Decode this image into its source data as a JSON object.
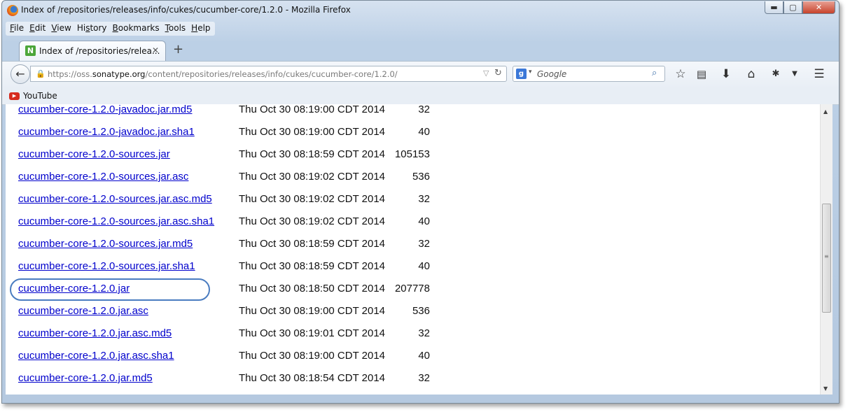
{
  "window": {
    "title": "Index of /repositories/releases/info/cukes/cucumber-core/1.2.0 - Mozilla Firefox",
    "controls": {
      "minimize": "▬",
      "maximize": "▢",
      "close": "✕"
    }
  },
  "menu": [
    {
      "key": "F",
      "rest": "ile"
    },
    {
      "key": "E",
      "rest": "dit"
    },
    {
      "key": "V",
      "rest": "iew"
    },
    {
      "key": "",
      "pre": "Hi",
      "mid": "s",
      "rest": "tory"
    },
    {
      "key": "B",
      "rest": "ookmarks"
    },
    {
      "key": "T",
      "rest": "ools"
    },
    {
      "key": "H",
      "rest": "elp"
    }
  ],
  "tab": {
    "favicon": "N",
    "title": "Index of /repositories/relea...",
    "close_icon": "✕",
    "new_tab_icon": "+"
  },
  "navbar": {
    "url_prefix": "https://oss.",
    "url_host": "sonatype.org",
    "url_path": "/content/repositories/releases/info/cukes/cucumber-core/1.2.0/",
    "search_engine_icon": "g",
    "search_placeholder": "Google",
    "icons": [
      "back-arrow-icon",
      "lock-icon",
      "reload-icon",
      "search-go-icon",
      "bookmark-star-icon",
      "reading-list-icon",
      "download-icon",
      "home-icon",
      "addon-icon",
      "overflow-chevron-icon",
      "hamburger-menu-icon"
    ]
  },
  "bookmarks": [
    {
      "label": "YouTube",
      "icon": "youtube-icon"
    }
  ],
  "files": [
    {
      "name": "cucumber-core-1.2.0-javadoc.jar.md5",
      "date": "Thu Oct 30 08:19:00 CDT 2014",
      "size": "32"
    },
    {
      "name": "cucumber-core-1.2.0-javadoc.jar.sha1",
      "date": "Thu Oct 30 08:19:00 CDT 2014",
      "size": "40"
    },
    {
      "name": "cucumber-core-1.2.0-sources.jar",
      "date": "Thu Oct 30 08:18:59 CDT 2014",
      "size": "105153"
    },
    {
      "name": "cucumber-core-1.2.0-sources.jar.asc",
      "date": "Thu Oct 30 08:19:02 CDT 2014",
      "size": "536"
    },
    {
      "name": "cucumber-core-1.2.0-sources.jar.asc.md5",
      "date": "Thu Oct 30 08:19:02 CDT 2014",
      "size": "32"
    },
    {
      "name": "cucumber-core-1.2.0-sources.jar.asc.sha1",
      "date": "Thu Oct 30 08:19:02 CDT 2014",
      "size": "40"
    },
    {
      "name": "cucumber-core-1.2.0-sources.jar.md5",
      "date": "Thu Oct 30 08:18:59 CDT 2014",
      "size": "32"
    },
    {
      "name": "cucumber-core-1.2.0-sources.jar.sha1",
      "date": "Thu Oct 30 08:18:59 CDT 2014",
      "size": "40"
    },
    {
      "name": "cucumber-core-1.2.0.jar",
      "date": "Thu Oct 30 08:18:50 CDT 2014",
      "size": "207778"
    },
    {
      "name": "cucumber-core-1.2.0.jar.asc",
      "date": "Thu Oct 30 08:19:00 CDT 2014",
      "size": "536"
    },
    {
      "name": "cucumber-core-1.2.0.jar.asc.md5",
      "date": "Thu Oct 30 08:19:01 CDT 2014",
      "size": "32"
    },
    {
      "name": "cucumber-core-1.2.0.jar.asc.sha1",
      "date": "Thu Oct 30 08:19:00 CDT 2014",
      "size": "40"
    },
    {
      "name": "cucumber-core-1.2.0.jar.md5",
      "date": "Thu Oct 30 08:18:54 CDT 2014",
      "size": "32"
    }
  ],
  "highlighted_file": "cucumber-core-1.2.0.jar",
  "colors": {
    "link": "#0000cc",
    "highlight_ring": "#4a7cc0"
  }
}
